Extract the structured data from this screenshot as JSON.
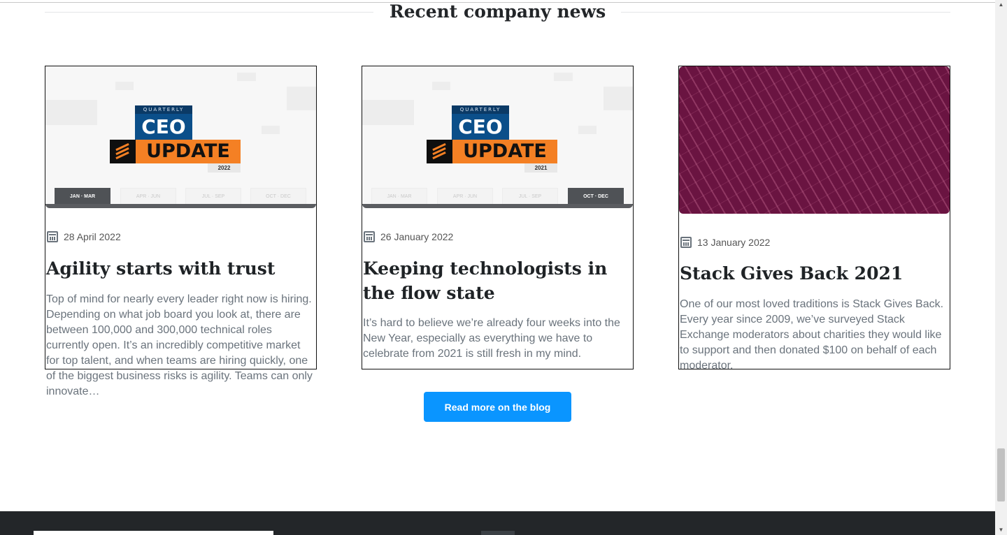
{
  "section": {
    "title": "Recent company news"
  },
  "posts": [
    {
      "image": {
        "badge_top": "QUARTERLY",
        "badge_ceo": "CEO",
        "badge_update": "UPDATE",
        "badge_year": "2022",
        "quarters": [
          "JAN · MAR",
          "APR · JUN",
          "JUL · SEP",
          "OCT · DEC"
        ],
        "active_quarter": "JAN · MAR"
      },
      "date": "28 April 2022",
      "title": "Agility starts with trust",
      "excerpt": "Top of mind for nearly every leader right now is hiring. Depending on what job board you look at, there are between 100,000 and 300,000 technical roles currently open. It’s an incredibly competitive market for top talent, and when teams are hiring quickly, one of the biggest business risks is agility. Teams can only innovate…"
    },
    {
      "image": {
        "badge_top": "QUARTERLY",
        "badge_ceo": "CEO",
        "badge_update": "UPDATE",
        "badge_year": "2021",
        "quarters": [
          "JAN · MAR",
          "APR · JUN",
          "JUL · SEP",
          "OCT · DEC"
        ],
        "active_quarter": "OCT · DEC"
      },
      "date": "26 January 2022",
      "title": "Keeping technologists in the flow state",
      "excerpt": "It’s hard to believe we’re already four weeks into the New Year, especially as everything we have to celebrate from 2021 is still fresh in my mind."
    },
    {
      "date": "13 January 2022",
      "title": "Stack Gives Back 2021",
      "excerpt": "One of our most loved traditions is Stack Gives Back. Every year since 2009, we’ve surveyed Stack Exchange moderators about charities they would like to support and then donated $100 on behalf of each moderator."
    }
  ],
  "cta": {
    "label": "Read more on the blog"
  },
  "colors": {
    "accent": "#0a95ff",
    "orange": "#f48024",
    "navy": "#0b4f8a",
    "maroon": "#6a1441",
    "footer": "#232629"
  }
}
